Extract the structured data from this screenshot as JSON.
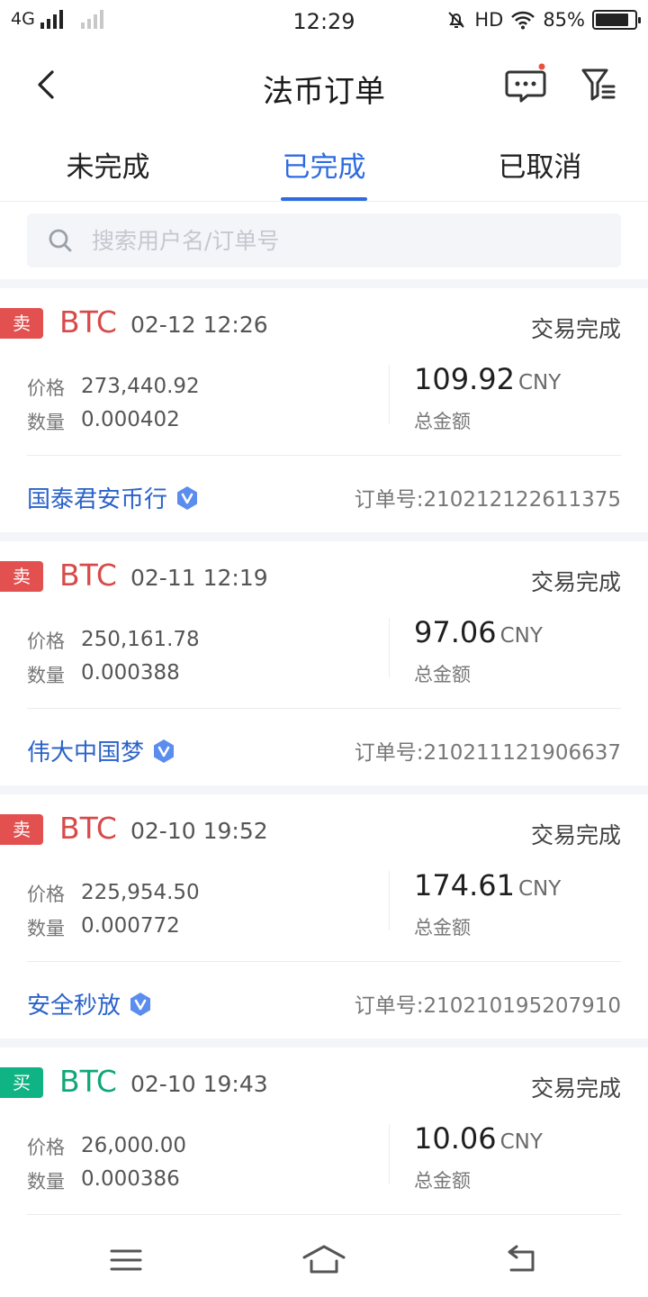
{
  "status_bar": {
    "network": "4G",
    "time": "12:29",
    "hd": "HD",
    "battery": "85%",
    "battery_level": 0.85
  },
  "header": {
    "title": "法币订单",
    "back_icon": "back-arrow-icon",
    "message_icon": "message-bubble-icon",
    "filter_icon": "filter-icon",
    "has_unread_dot": true
  },
  "tabs": [
    {
      "label": "未完成",
      "active": false
    },
    {
      "label": "已完成",
      "active": true
    },
    {
      "label": "已取消",
      "active": false
    }
  ],
  "search": {
    "placeholder": "搜索用户名/订单号",
    "value": ""
  },
  "labels": {
    "price": "价格",
    "quantity": "数量",
    "total": "总金额",
    "order_no_prefix": "订单号:"
  },
  "orders": [
    {
      "side": "卖",
      "side_type": "sell",
      "coin": "BTC",
      "time": "02-12 12:26",
      "status": "交易完成",
      "price": "273,440.92",
      "quantity": "0.000402",
      "total": "109.92",
      "currency": "CNY",
      "merchant": "国泰君安币行",
      "order_no": "订单号:210212122611375"
    },
    {
      "side": "卖",
      "side_type": "sell",
      "coin": "BTC",
      "time": "02-11 12:19",
      "status": "交易完成",
      "price": "250,161.78",
      "quantity": "0.000388",
      "total": "97.06",
      "currency": "CNY",
      "merchant": "伟大中国梦",
      "order_no": "订单号:210211121906637"
    },
    {
      "side": "卖",
      "side_type": "sell",
      "coin": "BTC",
      "time": "02-10 19:52",
      "status": "交易完成",
      "price": "225,954.50",
      "quantity": "0.000772",
      "total": "174.61",
      "currency": "CNY",
      "merchant": "安全秒放",
      "order_no": "订单号:210210195207910"
    },
    {
      "side": "买",
      "side_type": "buy",
      "coin": "BTC",
      "time": "02-10 19:43",
      "status": "交易完成",
      "price": "26,000.00",
      "quantity": "0.000386",
      "total": "10.06",
      "currency": "CNY"
    }
  ],
  "colors": {
    "accent": "#2f6be0",
    "sell": "#e25050",
    "buy": "#10b383",
    "merchant": "#2a62c9"
  }
}
